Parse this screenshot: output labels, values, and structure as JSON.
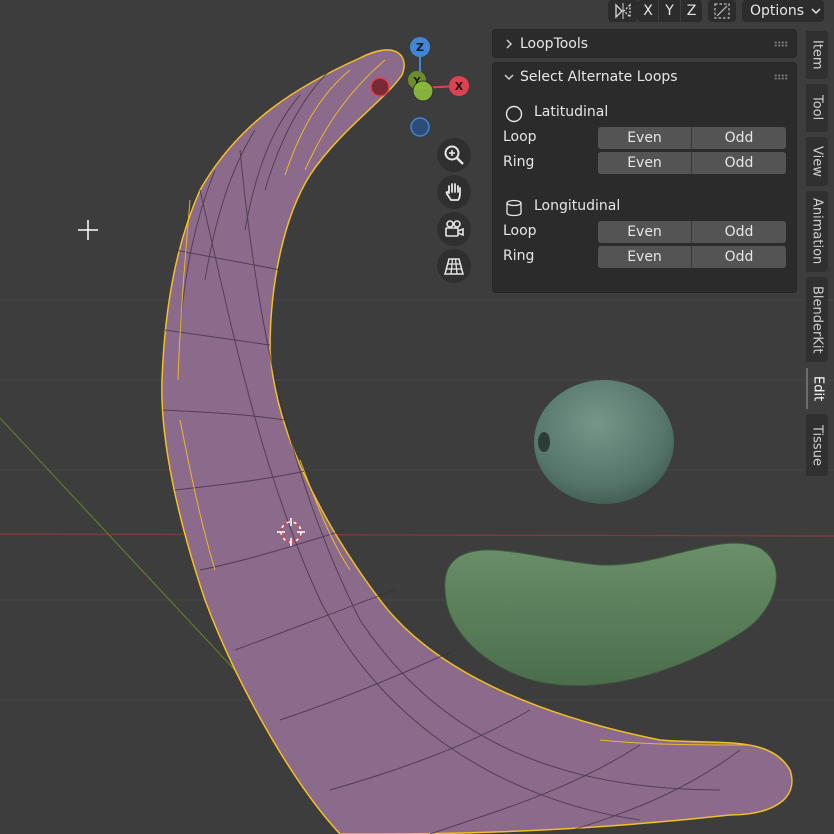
{
  "header": {
    "axis_x": "X",
    "axis_y": "Y",
    "axis_z": "Z",
    "options_label": "Options"
  },
  "gizmo": {
    "x": "X",
    "y": "Y",
    "z": "Z"
  },
  "panels": {
    "looptools": {
      "title": "LoopTools"
    },
    "select_alternate": {
      "title": "Select Alternate Loops",
      "latitudinal": {
        "label": "Latitudinal",
        "rows": [
          {
            "label": "Loop",
            "even": "Even",
            "odd": "Odd"
          },
          {
            "label": "Ring",
            "even": "Even",
            "odd": "Odd"
          }
        ]
      },
      "longitudinal": {
        "label": "Longitudinal",
        "rows": [
          {
            "label": "Loop",
            "even": "Even",
            "odd": "Odd"
          },
          {
            "label": "Ring",
            "even": "Even",
            "odd": "Odd"
          }
        ]
      }
    }
  },
  "sidebar_tabs": [
    "Item",
    "Tool",
    "View",
    "Animation",
    "BlenderKit",
    "Edit",
    "Tissue"
  ],
  "active_tab": "Edit",
  "colors": {
    "background": "#3d3d3d",
    "mesh_fill": "#8c6a8c",
    "selection_edge": "#f2c023",
    "sphere": "#5f7f74",
    "blob": "#5b7f5b",
    "x_axis": "#e0404f",
    "y_axis": "#8cbf3a",
    "z_axis": "#3f86d6"
  }
}
